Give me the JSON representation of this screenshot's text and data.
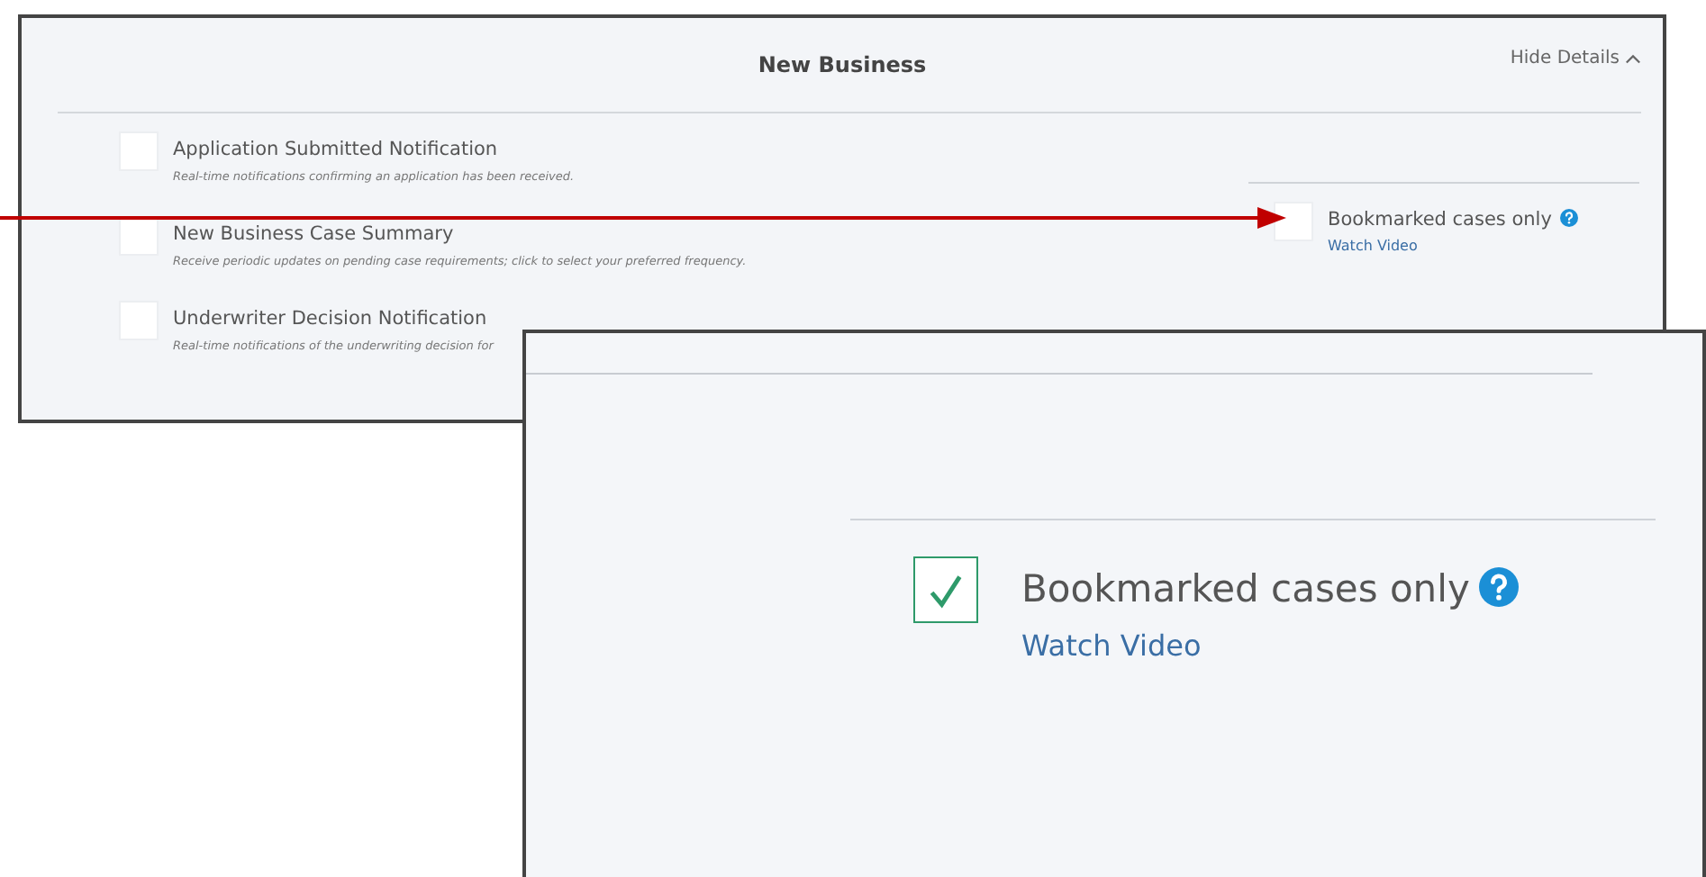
{
  "panel": {
    "title": "New Business",
    "toggle": {
      "label": "Hide Details",
      "expanded": true
    },
    "notifications": [
      {
        "title": "Application Submitted Notification",
        "description": "Real-time notifications confirming an application has been received.",
        "checked": false
      },
      {
        "title": "New Business Case Summary",
        "description": "Receive periodic updates on pending case requirements; click to select your preferred frequency.",
        "checked": false
      },
      {
        "title": "Underwriter Decision Notification",
        "description": "Real-time notifications of the underwriting decision for",
        "checked": false
      }
    ],
    "bookmark_option": {
      "label": "Bookmarked cases only",
      "link": "Watch Video",
      "checked": false
    }
  },
  "zoomed_inset": {
    "bookmark_option": {
      "label": "Bookmarked cases only",
      "link": "Watch Video",
      "checked": true
    }
  }
}
